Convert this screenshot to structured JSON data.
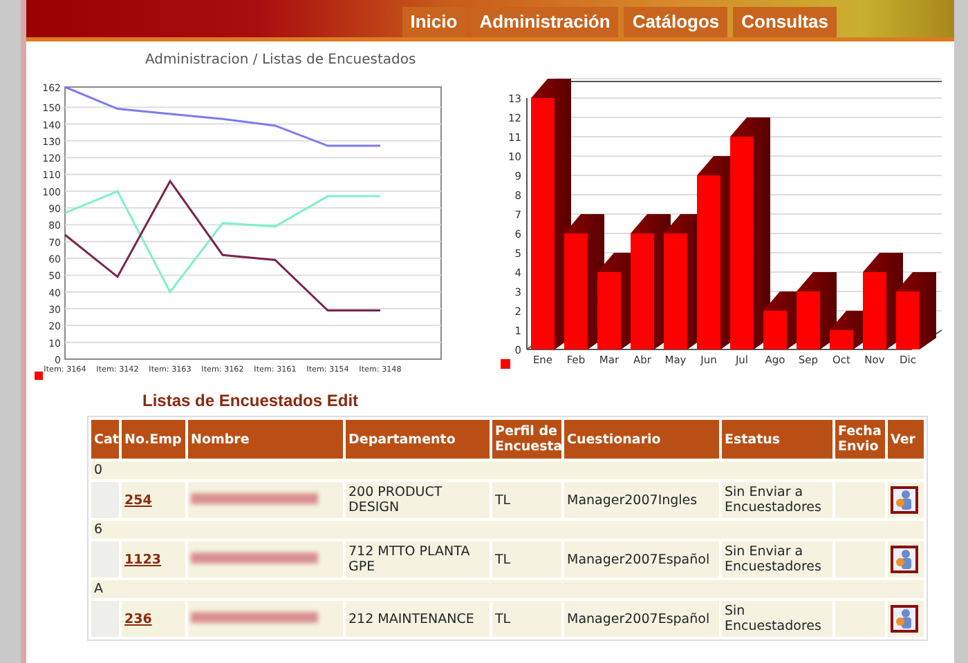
{
  "nav": [
    {
      "label": "Inicio",
      "selected": false
    },
    {
      "label": "Administración",
      "selected": false
    },
    {
      "label": "Catálogos",
      "selected": false
    },
    {
      "label": "Consultas",
      "selected": false
    }
  ],
  "breadcrumb": "Administracion / Listas de Encuestados",
  "line_chart": {
    "chart_data": {
      "type": "line",
      "grid": true,
      "categories": [
        "Item: 3164",
        "Item: 3142",
        "Item: 3163",
        "Item: 3162",
        "Item: 3161",
        "Item: 3154",
        "Item: 3148"
      ],
      "ylim": [
        0,
        162
      ],
      "yticks": [
        0,
        10,
        20,
        30,
        40,
        50,
        60,
        70,
        80,
        90,
        100,
        110,
        120,
        130,
        140,
        150,
        162
      ],
      "series": [
        {
          "color": "#7b7bf0",
          "values": [
            162,
            149,
            146,
            143,
            139,
            127,
            127
          ]
        },
        {
          "color": "#7ff0c8",
          "values": [
            87,
            100,
            40,
            81,
            79,
            97,
            97
          ]
        },
        {
          "color": "#7a2450",
          "values": [
            74,
            49,
            106,
            62,
            59,
            29,
            29
          ]
        }
      ]
    }
  },
  "bar_chart": {
    "chart_data": {
      "type": "bar",
      "grid": true,
      "categories": [
        "Ene",
        "Feb",
        "Mar",
        "Abr",
        "May",
        "Jun",
        "Jul",
        "Ago",
        "Sep",
        "Oct",
        "Nov",
        "Dic"
      ],
      "ylim": [
        0,
        13
      ],
      "yticks": [
        0,
        1,
        2,
        3,
        4,
        5,
        6,
        7,
        8,
        9,
        10,
        11,
        12,
        13
      ],
      "series": [
        {
          "color": "#ff0000",
          "values": [
            13,
            6,
            4,
            6,
            6,
            9,
            11,
            2,
            3,
            1,
            4,
            3
          ]
        }
      ]
    }
  },
  "table": {
    "title": "Listas de Encuestados Edit",
    "columns": [
      "Cat",
      "No.Emp",
      "Nombre",
      "Departamento",
      "Perfil de Encuesta",
      "Cuestionario",
      "Estatus",
      "Fecha Envio",
      "Ver"
    ],
    "groups": [
      {
        "label": "0",
        "rows": [
          {
            "no_emp": "254",
            "departamento": "200 PRODUCT DESIGN",
            "perfil": "TL",
            "cuestionario": "Manager2007Ingles",
            "estatus": "Sin Enviar a Encuestadores"
          }
        ]
      },
      {
        "label": "6",
        "rows": [
          {
            "no_emp": "1123",
            "departamento": "712 MTTO PLANTA GPE",
            "perfil": "TL",
            "cuestionario": "Manager2007Español",
            "estatus": "Sin Enviar a Encuestadores"
          }
        ]
      },
      {
        "label": "A",
        "rows": [
          {
            "no_emp": "236",
            "departamento": "212 MAINTENANCE",
            "perfil": "TL",
            "cuestionario": "Manager2007Español",
            "estatus": "Sin Encuestadores"
          }
        ]
      }
    ]
  }
}
